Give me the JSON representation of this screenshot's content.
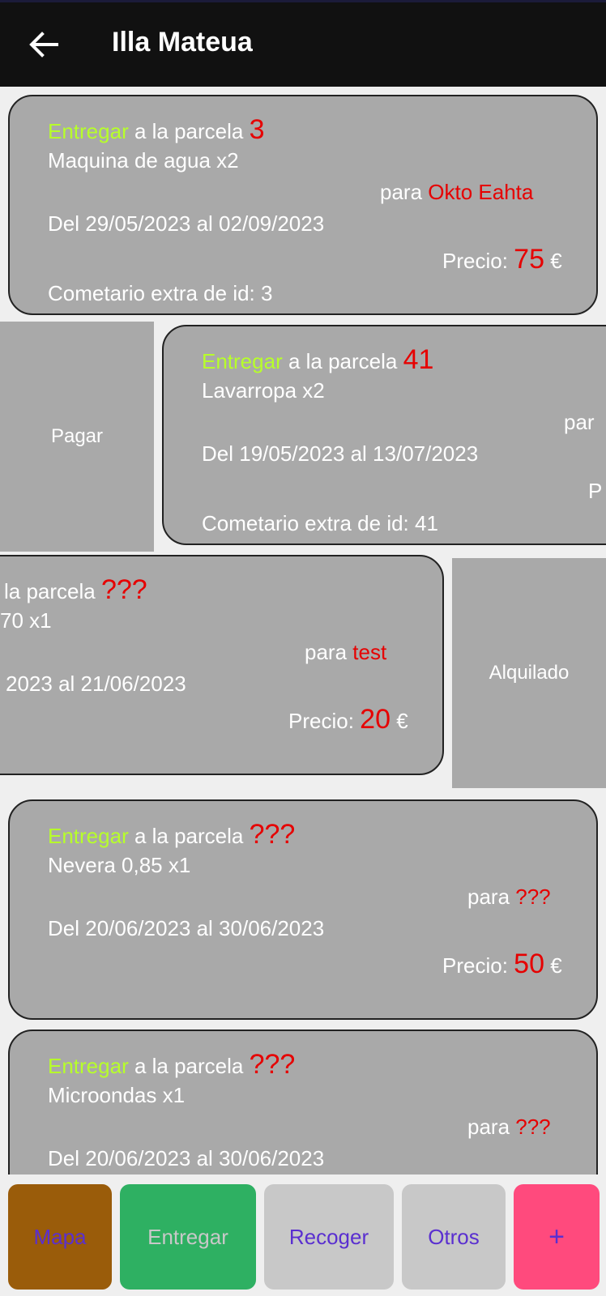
{
  "header": {
    "title": "Illa Mateua",
    "back_icon": "arrow-left-icon"
  },
  "cards": [
    {
      "action": "Entregar",
      "parcel_prefix": " a la parcela ",
      "parcel": "3",
      "item": "Maquina de agua x2",
      "para_label": "para ",
      "client": "Okto Eahta",
      "dates": "Del 29/05/2023 al 02/09/2023",
      "price_label": "Precio: ",
      "price": "75",
      "currency": " €",
      "comment": "Cometario extra de id: 3"
    },
    {
      "action": "Entregar",
      "parcel_prefix": " a la parcela ",
      "parcel": "41",
      "item": "Lavarropa x2",
      "para_label": "par",
      "dates": "Del 19/05/2023 al 13/07/2023",
      "price_label": "P",
      "comment": "Cometario extra de id: 41"
    },
    {
      "parcel_prefix": " la parcela ",
      "parcel": "???",
      "item": "70 x1",
      "para_label": "para ",
      "client": "test",
      "dates": "2023 al 21/06/2023",
      "price_label": "Precio: ",
      "price": "20",
      "currency": " €"
    },
    {
      "action": "Entregar",
      "parcel_prefix": " a la parcela ",
      "parcel": "???",
      "item": "Nevera 0,85 x1",
      "para_label": "para ",
      "client": "???",
      "dates": "Del 20/06/2023 al 30/06/2023",
      "price_label": "Precio: ",
      "price": "50",
      "currency": " €"
    },
    {
      "action": "Entregar",
      "parcel_prefix": " a la parcela ",
      "parcel": "???",
      "item": "Microondas x1",
      "para_label": "para ",
      "client": "???",
      "dates": "Del 20/06/2023 al 30/06/2023"
    }
  ],
  "swipe_actions": {
    "pay": "Pagar",
    "rented": "Alquilado"
  },
  "nav": {
    "mapa": "Mapa",
    "entregar": "Entregar",
    "recoger": "Recoger",
    "otros": "Otros",
    "add": "+"
  },
  "colors": {
    "appbar": "#111111",
    "card": "#a9a9a9",
    "action_green": "#b7ff2a",
    "parcel_red": "#e60000",
    "item_crimson": "#d2113e",
    "nav_mapa": "#9a5c0a",
    "nav_entregar": "#2eb062",
    "nav_neutral": "#c8c8c8",
    "nav_add": "#ff4a7d",
    "nav_text_purple": "#5a2fd0"
  }
}
